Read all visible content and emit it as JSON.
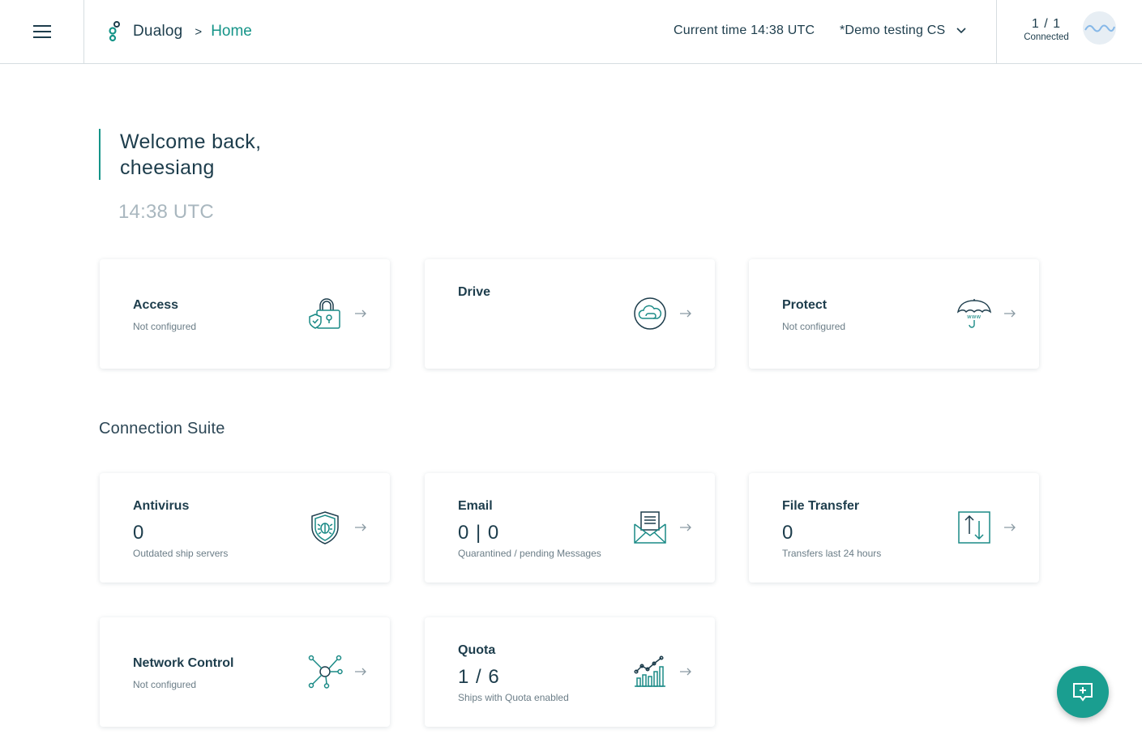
{
  "header": {
    "brand": "Dualog",
    "breadcrumb_sep": ">",
    "breadcrumb_current": "Home",
    "current_time": "Current time 14:38 UTC",
    "account": "*Demo testing CS",
    "connection_count": "1 / 1",
    "connection_label": "Connected"
  },
  "welcome": {
    "line1": "Welcome back,",
    "line2": "cheesiang",
    "time": "14:38 UTC"
  },
  "top_cards": [
    {
      "title": "Access",
      "subtitle": "Not configured",
      "icon": "lock-shield-icon"
    },
    {
      "title": "Drive",
      "subtitle": "",
      "icon": "cloud-icon"
    },
    {
      "title": "Protect",
      "subtitle": "Not configured",
      "icon": "umbrella-icon"
    }
  ],
  "section_title": "Connection Suite",
  "suite_cards": [
    {
      "title": "Antivirus",
      "value": "0",
      "subtitle": "Outdated ship servers",
      "icon": "bug-shield-icon"
    },
    {
      "title": "Email",
      "value": "0 | 0",
      "subtitle": "Quarantined / pending Messages",
      "icon": "envelope-icon"
    },
    {
      "title": "File Transfer",
      "value": "0",
      "subtitle": "Transfers last 24 hours",
      "icon": "transfer-arrows-icon"
    },
    {
      "title": "Network Control",
      "value": "",
      "subtitle": "Not configured",
      "icon": "network-icon"
    },
    {
      "title": "Quota",
      "value": "1 / 6",
      "subtitle": "Ships with Quota enabled",
      "icon": "bar-chart-icon"
    }
  ],
  "colors": {
    "accent": "#159488",
    "text": "#1d3d4c",
    "icon": "#1a8a86",
    "fab": "#1a9e90"
  }
}
